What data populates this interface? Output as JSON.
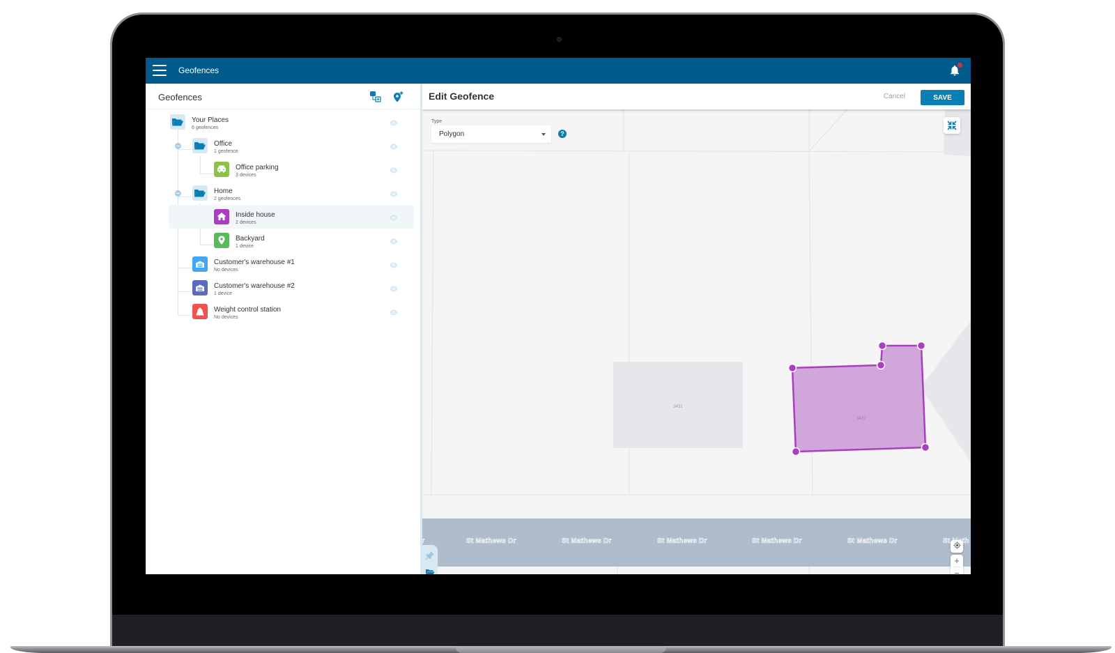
{
  "appbar": {
    "title": "Geofences",
    "menu_icon": "hamburger-menu-icon",
    "notification_icon": "bell-icon",
    "has_unread_notification": true
  },
  "left_panel": {
    "title": "Geofences",
    "actions": [
      {
        "name": "group-geofences-button",
        "icon": "group-add-icon"
      },
      {
        "name": "add-geofence-button",
        "icon": "add-location-icon"
      }
    ],
    "tree": [
      {
        "id": "your-places",
        "name": "Your Places",
        "sub": "6 geofences",
        "type": "folder",
        "level": 0,
        "icon_color": "#0a7fb5",
        "icon_bg": "#d9e9f3"
      },
      {
        "id": "office",
        "name": "Office",
        "sub": "1 geofence",
        "type": "folder",
        "level": 1,
        "expanded": true,
        "icon_color": "#0a7fb5",
        "icon_bg": "#d9e9f3"
      },
      {
        "id": "office-parking",
        "name": "Office parking",
        "sub": "3 devices",
        "type": "car",
        "level": 2,
        "icon_bg": "#8bc34a"
      },
      {
        "id": "home",
        "name": "Home",
        "sub": "2 geofences",
        "type": "folder",
        "level": 1,
        "expanded": true,
        "icon_color": "#0a7fb5",
        "icon_bg": "#d9e9f3"
      },
      {
        "id": "inside-house",
        "name": "Inside house",
        "sub": "2 devices",
        "type": "home",
        "level": 2,
        "icon_bg": "#a93fc0",
        "selected": true
      },
      {
        "id": "backyard",
        "name": "Backyard",
        "sub": "1 device",
        "type": "pin",
        "level": 2,
        "icon_bg": "#5cb85c"
      },
      {
        "id": "warehouse-1",
        "name": "Customer's warehouse #1",
        "sub": "No devices",
        "type": "warehouse",
        "level": 1,
        "icon_bg": "#42a5f5"
      },
      {
        "id": "warehouse-2",
        "name": "Customer's warehouse #2",
        "sub": "1 device",
        "type": "warehouse",
        "level": 1,
        "icon_bg": "#5c6bc0"
      },
      {
        "id": "weight-station",
        "name": "Weight control station",
        "sub": "No devices",
        "type": "weight",
        "level": 1,
        "icon_bg": "#ef5350"
      }
    ]
  },
  "editor": {
    "title": "Edit Geofence",
    "cancel_label": "Cancel",
    "save_label": "SAVE",
    "type_label": "Type",
    "type_value": "Polygon",
    "help_icon": "?"
  },
  "map": {
    "road_name": "St Mathews Dr",
    "road_labels": [
      "Dr",
      "St Mathews Dr",
      "St Mathews Dr",
      "St Mathews Dr",
      "St Mathews Dr",
      "St Mathews Dr",
      "St Math"
    ],
    "parcels": [
      {
        "label": "3431",
        "editing": false
      },
      {
        "label": "3437",
        "editing": true
      }
    ],
    "polygon_vertex_count": 6,
    "colors": {
      "polygon_fill": "#d1a6da",
      "polygon_stroke": "#a93fc0",
      "parcel_fill": "#e6e7ea",
      "road": "#aebccc",
      "background": "#f5f5f5"
    },
    "controls": {
      "fullscreen_icon": "collapse-arrows-icon",
      "locate_icon": "locate-icon",
      "zoom_in": "+",
      "zoom_out": "−",
      "pin_icon": "pin-icon",
      "folder_icon": "folder-open-icon"
    }
  },
  "colors": {
    "brand": "#005a8c",
    "accent": "#0a7fb5"
  }
}
